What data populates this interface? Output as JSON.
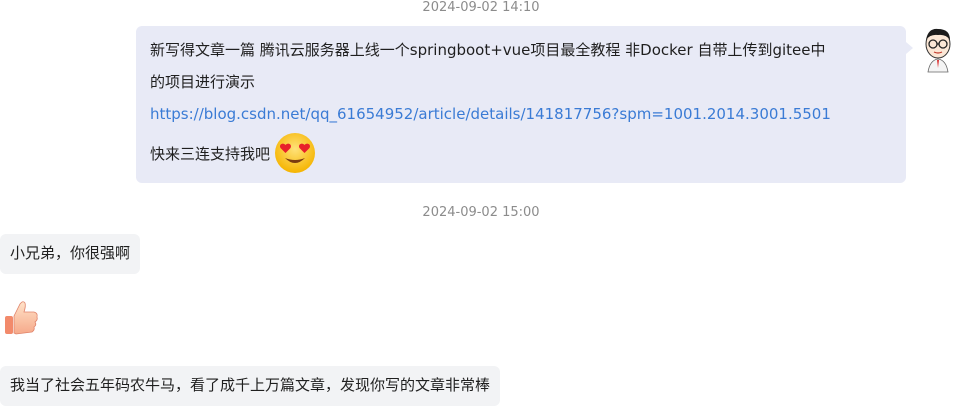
{
  "chat": {
    "timestamps": [
      "2024-09-02 14:10",
      "2024-09-02 15:00"
    ],
    "outgoing": {
      "line1": "新写得文章一篇 腾讯云服务器上线一个springboot+vue项目最全教程 非Docker 自带上传到gitee中",
      "line2": "的项目进行演示",
      "link": "https://blog.csdn.net/qq_61654952/article/details/141817756?spm=1001.2014.3001.5501",
      "cta": "快来三连支持我吧",
      "emoji_icon": "heart-eyes-emoji-icon",
      "avatar_icon": "cartoon-avatar-glasses"
    },
    "incoming": [
      {
        "text": "小兄弟，你很强啊"
      },
      {
        "emoji_icon": "thumbs-up-emoji-icon"
      },
      {
        "text": "我当了社会五年码农牛马，看了成千上万篇文章，发现你写的文章非常棒"
      }
    ]
  },
  "colors": {
    "outgoing_bubble": "#e8eaf6",
    "incoming_bubble": "#f2f3f5",
    "link": "#3a7bd5",
    "timestamp": "#8c8c8c"
  }
}
